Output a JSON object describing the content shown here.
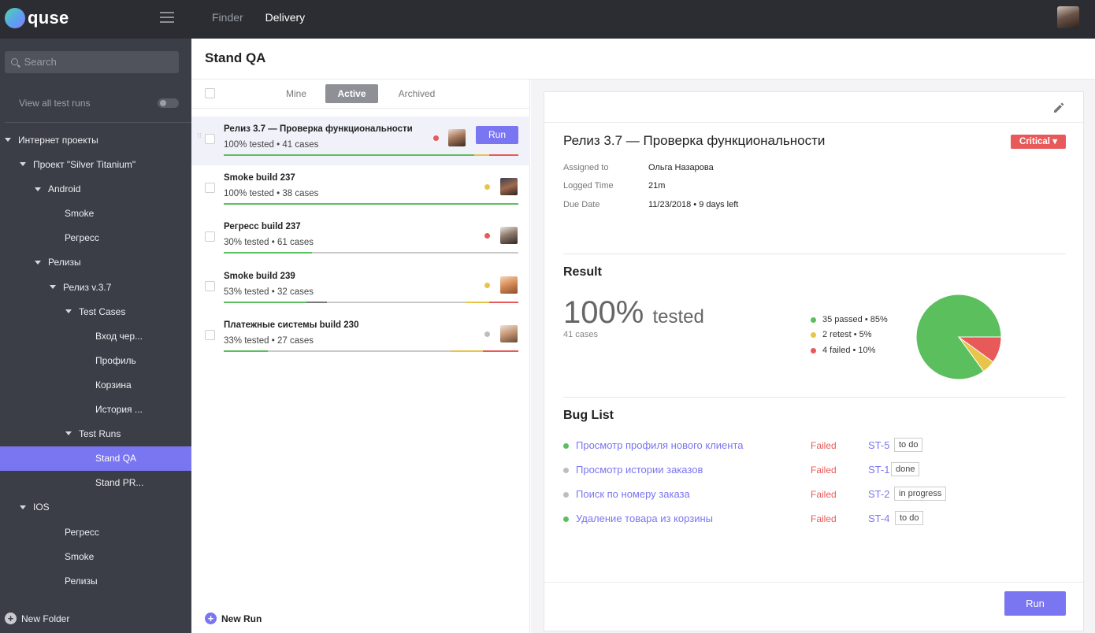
{
  "app": {
    "name": "quse"
  },
  "topnav": {
    "items": [
      "Finder",
      "Delivery"
    ],
    "active": "Delivery"
  },
  "sidebar": {
    "search_placeholder": "Search",
    "view_all_label": "View all test runs",
    "tree": [
      {
        "label": "Интернет проекты",
        "level": 0,
        "expandable": true
      },
      {
        "label": "Проект \"Silver Titanium\"",
        "level": 1,
        "expandable": true
      },
      {
        "label": "Android",
        "level": 2,
        "expandable": true
      },
      {
        "label": "Smoke",
        "level": 3,
        "expandable": false
      },
      {
        "label": "Регресс",
        "level": 3,
        "expandable": false
      },
      {
        "label": "Релизы",
        "level": 2,
        "expandable": true
      },
      {
        "label": "Релиз v.3.7",
        "level": 3,
        "expandable": true
      },
      {
        "label": "Test Cases",
        "level": 4,
        "expandable": true
      },
      {
        "label": "Вход чер...",
        "level": 5,
        "expandable": false
      },
      {
        "label": "Профиль",
        "level": 5,
        "expandable": false
      },
      {
        "label": "Корзина",
        "level": 5,
        "expandable": false
      },
      {
        "label": "История ...",
        "level": 5,
        "expandable": false
      },
      {
        "label": "Test Runs",
        "level": 4,
        "expandable": true
      },
      {
        "label": "Stand QA",
        "level": 5,
        "expandable": false,
        "selected": true
      },
      {
        "label": "Stand PR...",
        "level": 5,
        "expandable": false
      },
      {
        "label": "IOS",
        "level": 1,
        "expandable": true
      },
      {
        "label": "Регресс",
        "level": 3,
        "expandable": false
      },
      {
        "label": "Smoke",
        "level": 3,
        "expandable": false
      },
      {
        "label": "Релизы",
        "level": 3,
        "expandable": false
      }
    ],
    "new_folder_label": "New Folder"
  },
  "page": {
    "title": "Stand QA"
  },
  "list": {
    "tabs": [
      "Mine",
      "Active",
      "Archived"
    ],
    "active_tab": "Active",
    "runs": [
      {
        "name": "Релиз 3.7 — Проверка функциональности",
        "subtitle": "100% tested • 41 cases",
        "dot_color": "#e85a5a",
        "selected": true,
        "run_label": "Run",
        "progress": [
          {
            "color": "#5cbf5e",
            "frac": 0.85
          },
          {
            "color": "#e8c44a",
            "frac": 0.05
          },
          {
            "color": "#e85a5a",
            "frac": 0.1
          }
        ]
      },
      {
        "name": "Smoke build 237",
        "subtitle": "100% tested • 38 cases",
        "dot_color": "#e8c44a",
        "progress": [
          {
            "color": "#5cbf5e",
            "frac": 1.0
          }
        ]
      },
      {
        "name": "Регресс build 237",
        "subtitle": "30% tested • 61 cases",
        "dot_color": "#e85a5a",
        "progress": [
          {
            "color": "#5cbf5e",
            "frac": 0.3
          }
        ]
      },
      {
        "name": "Smoke build 239",
        "subtitle": "53% tested • 32 cases",
        "dot_color": "#e8c44a",
        "progress": [
          {
            "color": "#5cbf5e",
            "frac": 0.28
          },
          {
            "color": "#777",
            "frac": 0.07
          },
          {
            "color": "#c9c9c9",
            "frac": 0.47
          },
          {
            "color": "#e8c44a",
            "frac": 0.08
          },
          {
            "color": "#e85a5a",
            "frac": 0.1
          }
        ]
      },
      {
        "name": "Платежные системы build 230",
        "subtitle": "33% tested • 27 cases",
        "dot_color": "#bdbdbd",
        "progress": [
          {
            "color": "#5cbf5e",
            "frac": 0.15
          },
          {
            "color": "#c9c9c9",
            "frac": 0.62
          },
          {
            "color": "#e8c44a",
            "frac": 0.11
          },
          {
            "color": "#e85a5a",
            "frac": 0.12
          }
        ]
      }
    ],
    "new_run_label": "New Run"
  },
  "detail": {
    "title": "Релиз 3.7 — Проверка функциональности",
    "priority": "Critical ▾",
    "meta": [
      {
        "label": "Assigned to",
        "value": "Ольга Назарова"
      },
      {
        "label": "Logged Time",
        "value": "21m"
      },
      {
        "label": "Due Date",
        "value": "11/23/2018 • 9 days left"
      }
    ],
    "result": {
      "heading": "Result",
      "big_percent": "100%",
      "big_word": "tested",
      "cases": "41 cases",
      "legend": [
        {
          "label": "35 passed • 85%",
          "color": "#5cbf5e",
          "value": 85
        },
        {
          "label": "2 retest • 5%",
          "color": "#e8c44a",
          "value": 5
        },
        {
          "label": "4 failed • 10%",
          "color": "#e85a5a",
          "value": 10
        }
      ]
    },
    "bugs": {
      "heading": "Bug List",
      "items": [
        {
          "name": "Просмотр профиля нового клиента",
          "status": "Failed",
          "id": "ST-5",
          "tag": "to do",
          "dot": "#5cbf5e"
        },
        {
          "name": "Просмотр истории заказов",
          "status": "Failed",
          "id": "ST-1",
          "tag": "done",
          "dot": "#bdbdbd"
        },
        {
          "name": "Поиск по номеру заказа",
          "status": "Failed",
          "id": "ST-2",
          "tag": "in progress",
          "dot": "#bdbdbd"
        },
        {
          "name": "Удаление товара из корзины",
          "status": "Failed",
          "id": "ST-4",
          "tag": "to do",
          "dot": "#5cbf5e"
        }
      ]
    },
    "run_label": "Run"
  },
  "colors": {
    "accent": "#7a75f0",
    "sidebar_bg": "#3b3e46",
    "topbar_bg": "#2b2d33",
    "passed": "#5cbf5e",
    "retest": "#e8c44a",
    "failed": "#e85a5a"
  }
}
